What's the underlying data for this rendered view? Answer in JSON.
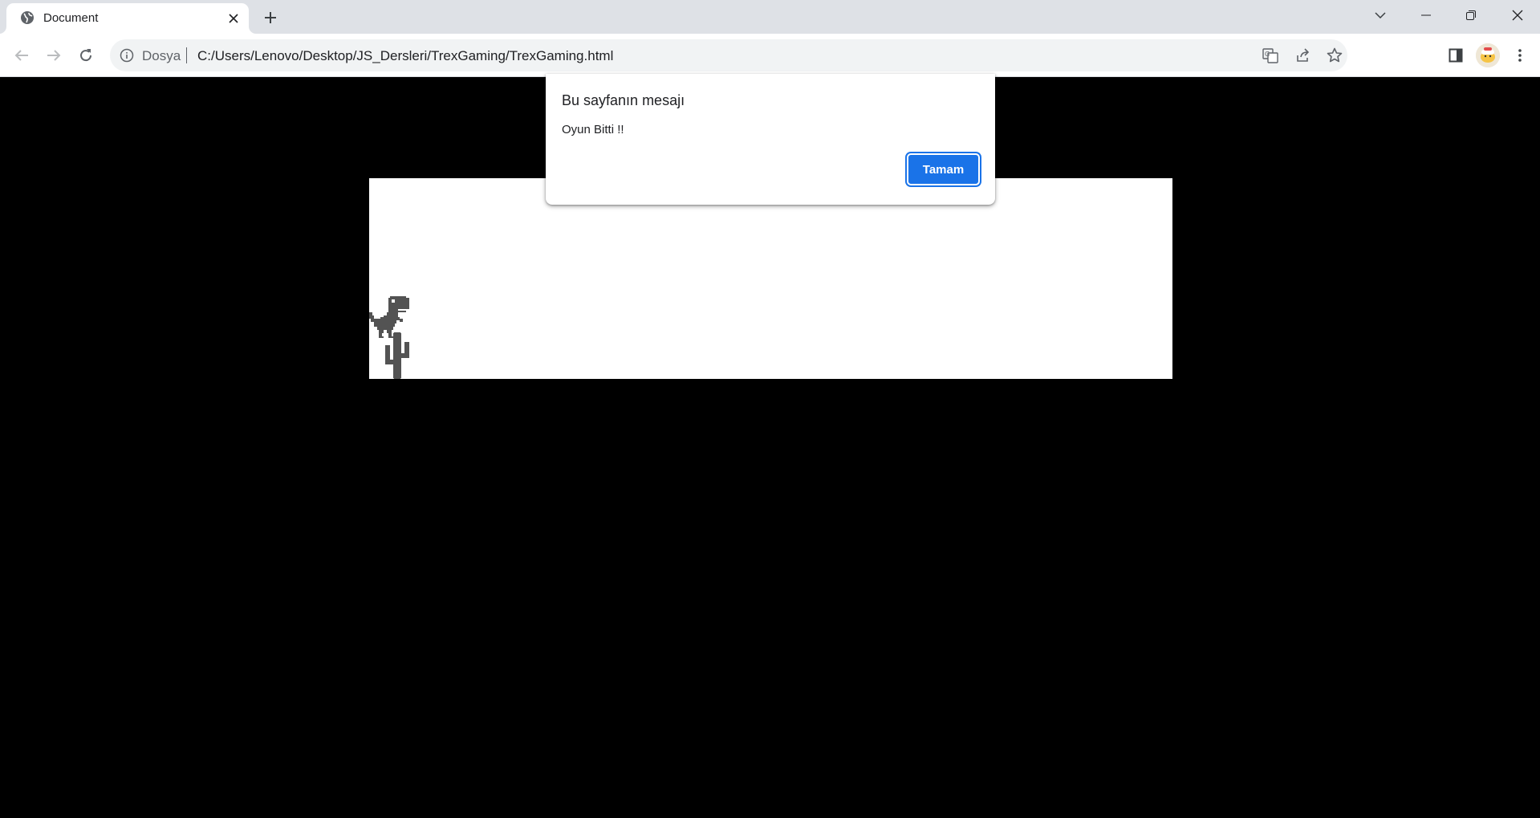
{
  "browser": {
    "tab": {
      "title": "Document",
      "favicon": "globe-icon"
    },
    "window_controls": [
      "tab-search-icon",
      "minimize-icon",
      "restore-icon",
      "close-icon"
    ],
    "address_bar": {
      "scheme_label": "Dosya",
      "url": "C:/Users/Lenovo/Desktop/JS_Dersleri/TrexGaming/TrexGaming.html"
    },
    "toolbar_icons": [
      "translate-icon",
      "share-icon",
      "bookmark-star-icon",
      "side-panel-icon",
      "profile-avatar",
      "menu-icon"
    ]
  },
  "page": {
    "background": "#000000",
    "game": {
      "background": "#ffffff",
      "sprite_color": "#535353",
      "characters": [
        "t-rex-sprite",
        "cactus-sprite"
      ]
    }
  },
  "dialog": {
    "title": "Bu sayfanın mesajı",
    "message": "Oyun Bitti !!",
    "ok_label": "Tamam",
    "accent": "#1a73e8"
  }
}
